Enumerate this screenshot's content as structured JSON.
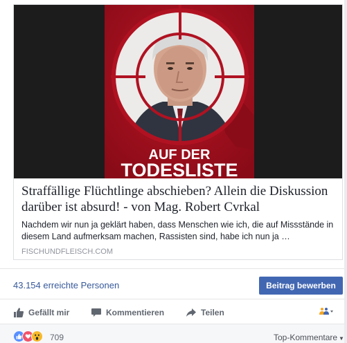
{
  "link_preview": {
    "image_text_line1": "AUF DER",
    "image_text_line2": "TODESLISTE",
    "title": "Straffällige Flüchtlinge abschieben? Allein die Diskussion darüber ist absurd! - von Mag. Robert Cvrkal",
    "description": "Nachdem wir nun ja geklärt haben, dass Menschen wie ich, die auf Missstände in diesem Land aufmerksam machen, Rassisten sind, habe ich nun ja …",
    "domain": "FISCHUNDFLEISCH.COM"
  },
  "insights": {
    "reach_text": "43.154 erreichte Personen",
    "boost_label": "Beitrag bewerben"
  },
  "actions": {
    "like_label": "Gefällt mir",
    "comment_label": "Kommentieren",
    "share_label": "Teilen"
  },
  "reactions": {
    "icons": [
      "like-reaction-icon",
      "love-reaction-icon",
      "wow-reaction-icon"
    ],
    "count": "709",
    "sort_label": "Top-Kommentare"
  },
  "colors": {
    "brand_blue": "#4267b2",
    "link_blue": "#365899",
    "like_blue": "#5890ff",
    "love_red": "#f25268",
    "wow_yellow": "#f7b928",
    "poster_red": "#a8101f"
  }
}
